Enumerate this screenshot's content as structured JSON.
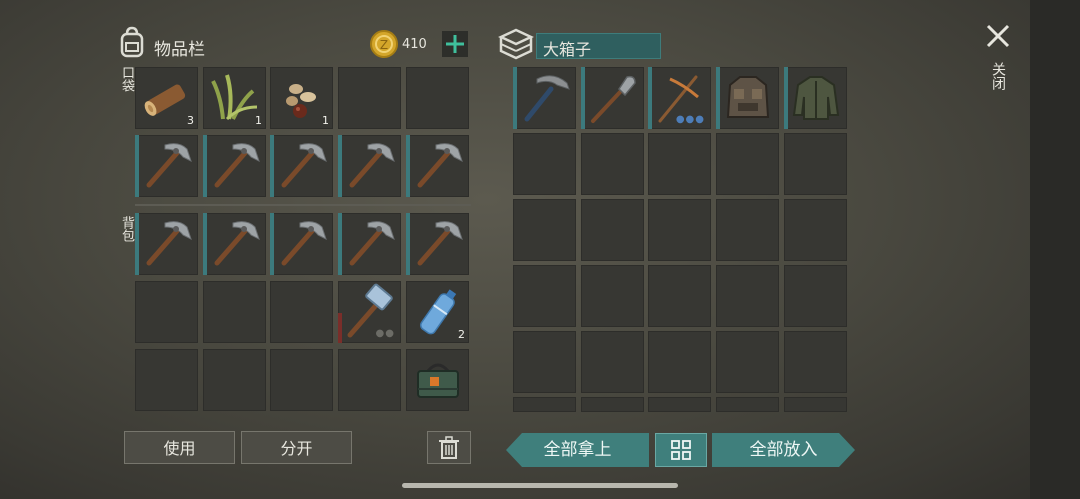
{
  "inventory": {
    "title": "物品栏",
    "coins": "410",
    "pocket_label": "口袋",
    "backpack_label": "背包",
    "pocket_counts": [
      "3",
      "1",
      "1"
    ],
    "backpack_counts": [
      "2"
    ]
  },
  "chest": {
    "title": "大箱子"
  },
  "buttons": {
    "use": "使用",
    "split": "分开",
    "take_all": "全部拿上",
    "put_all": "全部放入",
    "close": "关闭"
  },
  "icons": {
    "backpack": "backpack-icon",
    "coin": "coin-icon",
    "add": "plus-icon",
    "chest": "chest-icon",
    "close": "close-icon",
    "trash": "trash-icon",
    "sort": "grid-sort-icon"
  },
  "colors": {
    "accent": "#3f7f7c",
    "slot": "#373733",
    "slot_bar": "#3c7a7d"
  }
}
